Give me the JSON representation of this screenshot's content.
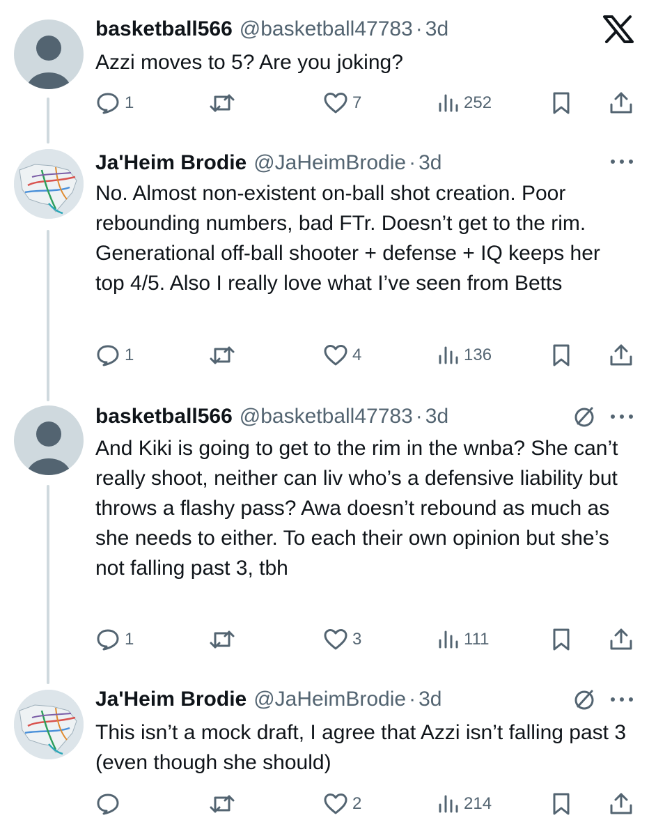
{
  "tweets": [
    {
      "name": "basketball566",
      "handle": "@basketball47783",
      "separator": "·",
      "time": "3d",
      "text": "Azzi moves to 5? Are you joking?",
      "avatar_icon": "default-avatar-icon",
      "corner_icon": "x-logo-icon",
      "stats": {
        "replies": "1",
        "reposts": "",
        "likes": "7",
        "views": "252"
      }
    },
    {
      "name": "Ja'Heim Brodie",
      "handle": "@JaHeimBrodie",
      "separator": "·",
      "time": "3d",
      "text": "No. Almost non-existent on-ball shot creation. Poor rebounding numbers, bad FTr. Doesn’t get to the rim. Generational off-ball shooter + defense + IQ keeps her top 4/5. Also I really love what I’ve seen from Betts",
      "avatar_icon": "map-avatar-icon",
      "corner_icon": "more-icon",
      "stats": {
        "replies": "1",
        "reposts": "",
        "likes": "4",
        "views": "136"
      }
    },
    {
      "name": "basketball566",
      "handle": "@basketball47783",
      "separator": "·",
      "time": "3d",
      "text": "And Kiki is going to get to the rim in the wnba? She can’t really shoot, neither can liv who’s a defensive liability but throws a flashy pass? Awa doesn’t rebound as much as she needs to either. To each their own opinion but she’s not falling past 3, tbh",
      "avatar_icon": "default-avatar-icon",
      "corner_icon": "more-icon",
      "stats": {
        "replies": "1",
        "reposts": "",
        "likes": "3",
        "views": "111"
      }
    },
    {
      "name": "Ja'Heim Brodie",
      "handle": "@JaHeimBrodie",
      "separator": "·",
      "time": "3d",
      "text": "This isn’t a mock draft, I agree that Azzi isn’t falling past 3 (even though she should)",
      "avatar_icon": "map-avatar-icon",
      "corner_icon": "more-icon",
      "stats": {
        "replies": "",
        "reposts": "",
        "likes": "2",
        "views": "214"
      }
    }
  ],
  "colors": {
    "text": "#0f1419",
    "secondary": "#536471",
    "thread_line": "#cfd9de",
    "avatar_bg": "#cfd9de",
    "avatar_figure": "#536471"
  }
}
